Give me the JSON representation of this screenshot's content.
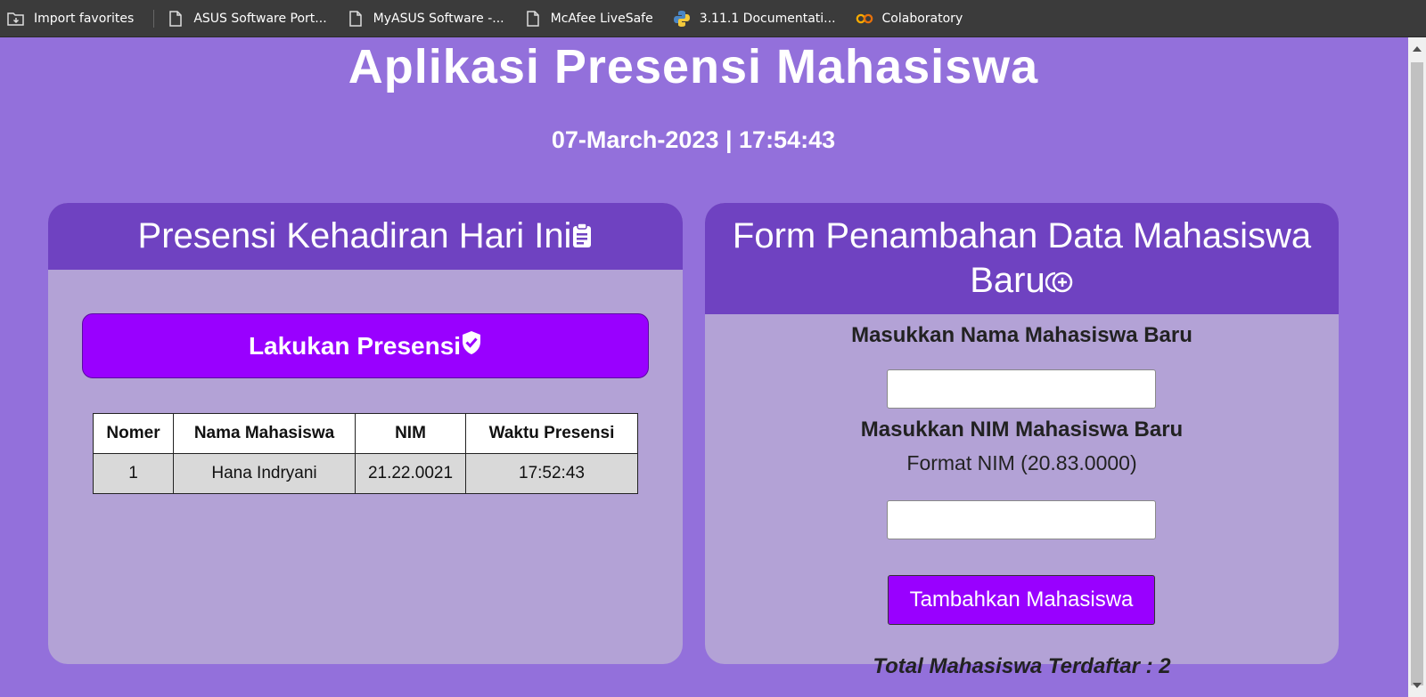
{
  "bookmarks": [
    {
      "label": "Import favorites",
      "icon": "import-folder-icon"
    },
    {
      "label": "ASUS Software Port...",
      "icon": "page-icon"
    },
    {
      "label": "MyASUS Software -...",
      "icon": "page-icon"
    },
    {
      "label": "McAfee LiveSafe",
      "icon": "page-icon"
    },
    {
      "label": "3.11.1 Documentati...",
      "icon": "python-icon"
    },
    {
      "label": "Colaboratory",
      "icon": "colab-icon"
    }
  ],
  "page": {
    "title": "Aplikasi Presensi Mahasiswa",
    "datetime": "07-March-2023 | 17:54:43"
  },
  "attendance": {
    "header": "Presensi Kehadiran Hari Ini",
    "header_icon": "clipboard-icon",
    "button_label": "Lakukan Presensi",
    "button_icon": "shield-check-icon",
    "columns": [
      "Nomer",
      "Nama Mahasiswa",
      "NIM",
      "Waktu Presensi"
    ],
    "rows": [
      {
        "no": "1",
        "name": "Hana Indryani",
        "nim": "21.22.0021",
        "time": "17:52:43"
      }
    ]
  },
  "form": {
    "header": "Form Penambahan Data Mahasiswa Baru",
    "header_icon": "add-circle-icon",
    "name_label": "Masukkan Nama Mahasiswa Baru",
    "name_value": "",
    "nim_label": "Masukkan NIM Mahasiswa Baru",
    "nim_hint": "Format NIM (20.83.0000)",
    "nim_value": "",
    "submit_label": "Tambahkan Mahasiswa",
    "total_label": "Total Mahasiswa Terdaftar : 2"
  },
  "colors": {
    "background": "#9370db",
    "header": "#6f42c1",
    "card": "#b3a2d6",
    "button": "#9900ff"
  }
}
